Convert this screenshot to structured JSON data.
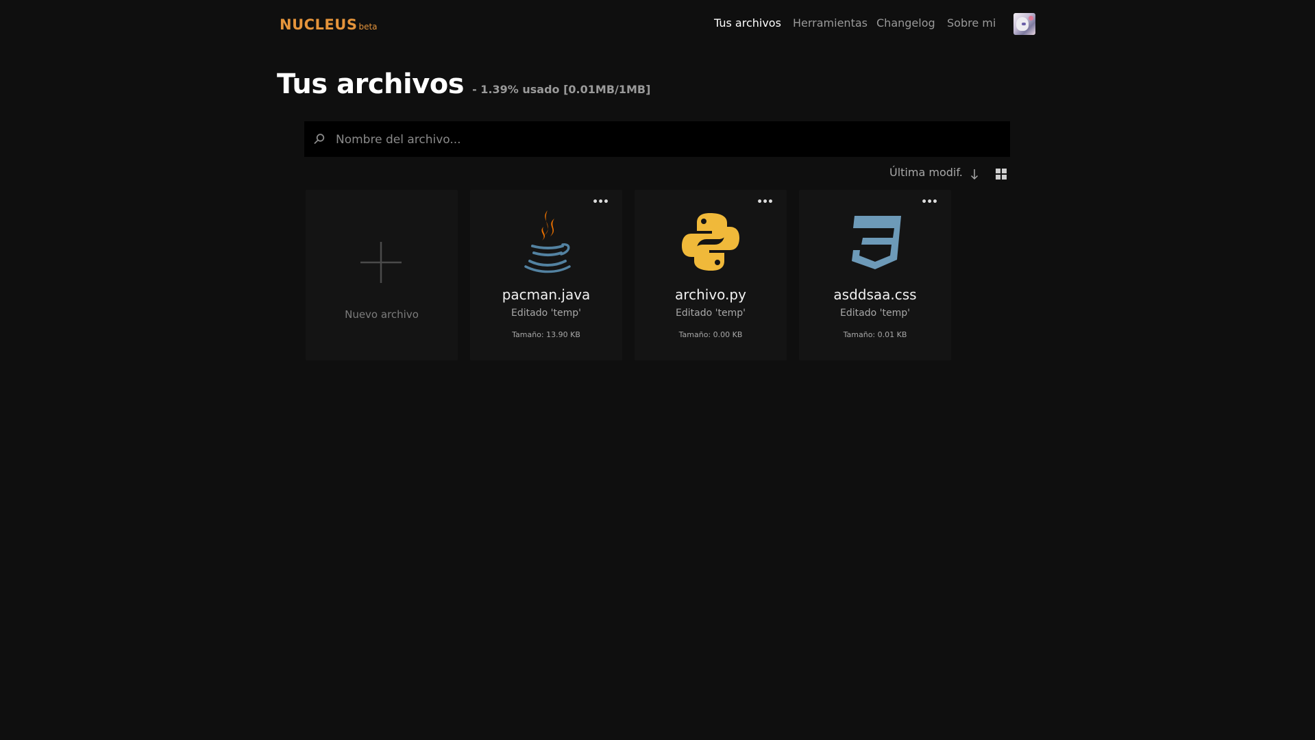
{
  "app": {
    "logo": "NUCLEUS",
    "logo_badge": "beta",
    "accent_color": "#e5943b"
  },
  "nav": {
    "items": [
      {
        "label": "Tus archivos",
        "active": true
      },
      {
        "label": "Herramientas",
        "active": false
      },
      {
        "label": "Changelog",
        "active": false
      },
      {
        "label": "Sobre mi",
        "active": false
      }
    ],
    "avatar_icon": "user-avatar"
  },
  "page": {
    "title": "Tus archivos",
    "usage": "- 1.39% usado [0.01MB/1MB]"
  },
  "search": {
    "placeholder": "Nombre del archivo...",
    "value": "",
    "icon": "search-icon"
  },
  "sort": {
    "label": "Última modif.",
    "direction_icon": "arrow-down-icon",
    "view_icon": "grid-view-icon"
  },
  "new_file": {
    "label": "Nuevo archivo",
    "icon": "plus-icon"
  },
  "files": [
    {
      "name": "pacman.java",
      "edited": "Editado 'temp'",
      "size": "Tamaño: 13.90 KB",
      "icon": "java-icon"
    },
    {
      "name": "archivo.py",
      "edited": "Editado 'temp'",
      "size": "Tamaño: 0.00 KB",
      "icon": "python-icon"
    },
    {
      "name": "asddsaa.css",
      "edited": "Editado 'temp'",
      "size": "Tamaño: 0.01 KB",
      "icon": "css3-icon"
    }
  ],
  "more_label": "•••"
}
